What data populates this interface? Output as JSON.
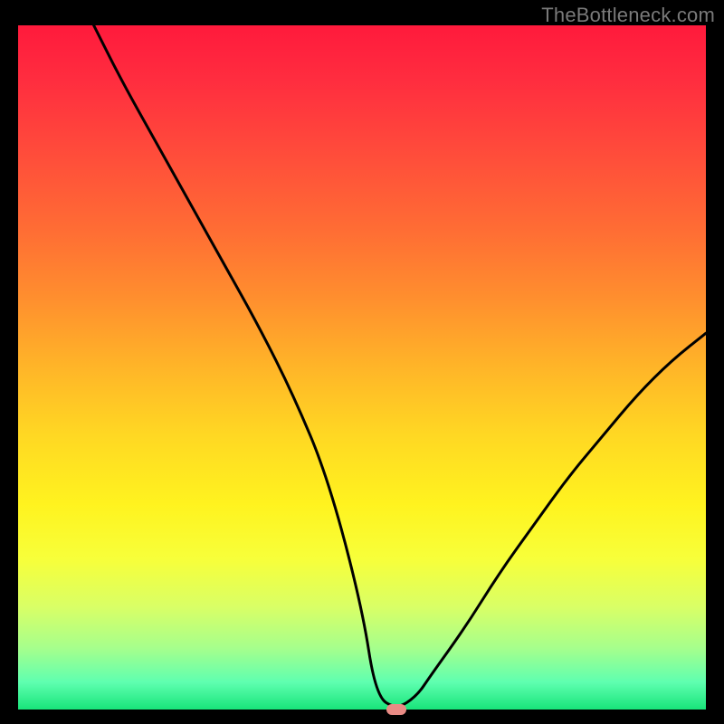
{
  "watermark": "TheBottleneck.com",
  "colors": {
    "frame": "#000000",
    "gradient_top": "#ff1a3c",
    "gradient_bottom": "#18e47a",
    "curve": "#000000",
    "marker": "#e98b85",
    "watermark_text": "#7a7a7a"
  },
  "chart_data": {
    "type": "line",
    "title": "",
    "xlabel": "",
    "ylabel": "",
    "xlim": [
      0,
      100
    ],
    "ylim": [
      0,
      100
    ],
    "grid": false,
    "legend": false,
    "comments": "Bottleneck % vs parameter. Single V-shaped curve; minimum ~0 near x≈55. Left arm decreases from ~100% at x≈11 to 0 at x≈52; right arm rises to ~55% at x=100. Marker shows optimum.",
    "series": [
      {
        "name": "bottleneck-curve",
        "x": [
          11,
          15,
          20,
          25,
          30,
          35,
          40,
          45,
          50,
          52,
          55,
          58,
          60,
          65,
          70,
          75,
          80,
          85,
          90,
          95,
          100
        ],
        "y": [
          100,
          92,
          83,
          74,
          65,
          56,
          46,
          34,
          15,
          2,
          0,
          2,
          5,
          12,
          20,
          27,
          34,
          40,
          46,
          51,
          55
        ]
      }
    ],
    "marker": {
      "x": 55,
      "y": 0
    }
  }
}
